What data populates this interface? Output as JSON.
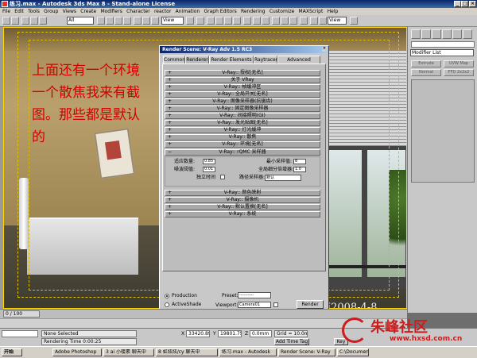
{
  "window": {
    "title": "练习.max - Autodesk 3ds Max 8 - Stand-alone License",
    "controls": [
      "_",
      "□",
      "×"
    ]
  },
  "menu": [
    "File",
    "Edit",
    "Tools",
    "Group",
    "Views",
    "Create",
    "Modifiers",
    "Character",
    "reactor",
    "Animation",
    "Graph Editors",
    "Rendering",
    "Customize",
    "MAXScript",
    "Help"
  ],
  "toolbar": {
    "filter_value": "All",
    "refcoord_value": "View",
    "named_sel_value": "View"
  },
  "viewport": {
    "annotation_lines": [
      "上面还有一个环境",
      "一个散焦我来有截",
      "图。那些都是默认",
      "的"
    ],
    "watermark": "跑 甫2008-4-8"
  },
  "command_panel": {
    "modifier_list": "Modifier List",
    "buttons": [
      "Extrude",
      "UVW Map",
      "Normal",
      "FFD 2x2x2"
    ]
  },
  "render_dialog": {
    "title": "Render Scene: V-Ray Adv 1.5 RC3",
    "tabs": [
      "Common",
      "Renderer",
      "Render Elements",
      "Raytracer",
      "Advanced Lighting"
    ],
    "active_tab": "Renderer",
    "rollouts_top": [
      "V-Ray:: 授权[无名]",
      "关于 VRay",
      "V-Ray:: 帧缓冲区",
      "V-Ray:: 全局开关[无名]",
      "V-Ray:: 图像采样器(抗锯齿)",
      "V-Ray:: 固定图像采样器",
      "V-Ray:: 间接照明(GI)",
      "V-Ray:: 发光贴图[无名]",
      "V-Ray:: 灯光缓冲",
      "V-Ray:: 散焦",
      "V-Ray:: 环境[无名]"
    ],
    "expanded_rollout": {
      "title": "V-Ray:: rQMC 采样器",
      "adaptive_amount_label": "适应数量:",
      "adaptive_amount_value": "0.85",
      "noise_threshold_label": "噪波阈值:",
      "noise_threshold_value": "0.01",
      "time_independent_label": "独立时间",
      "min_samples_label": "最小采样值:",
      "min_samples_value": "8",
      "global_subdivs_label": "全局细分倍增器:",
      "global_subdivs_value": "1.0",
      "path_sampler_label": "路径采样器:",
      "path_sampler_value": "默认"
    },
    "rollouts_bottom": [
      "V-Ray:: 颜色映射",
      "V-Ray:: 摄像机",
      "V-Ray:: 默认置换[无名]",
      "V-Ray:: 系统"
    ],
    "production_label": "Production",
    "activeshade_label": "ActiveShade",
    "preset_label": "Preset:",
    "preset_value": "----------",
    "viewport_label": "Viewport:",
    "viewport_value": "Camera01",
    "render_button": "Render"
  },
  "timeline": {
    "frame_display": "0 / 100"
  },
  "status": {
    "selection": "None Selected",
    "rendering_time": "Rendering Time 0:00:25",
    "x_label": "X",
    "x_value": "33420.89",
    "y_label": "Y",
    "y_value": "19801.75",
    "z_label": "Z",
    "z_value": "0.0mm",
    "grid": "Grid = 10.0mm",
    "add_time_tag": "Add Time Tag",
    "key": "Key"
  },
  "taskbar": {
    "start": "开始",
    "tasks": [
      "Adobe Photoshop",
      "3 ai 小楼素 聊天中",
      "8 虹炫炫/cy 聊天中",
      "练习.max - Autodesk",
      "Render Scene: V-Ray",
      "C:\\Documents and"
    ]
  },
  "site_logo": {
    "text": "朱峰社区",
    "url": "www.hxsd.com.cn"
  }
}
